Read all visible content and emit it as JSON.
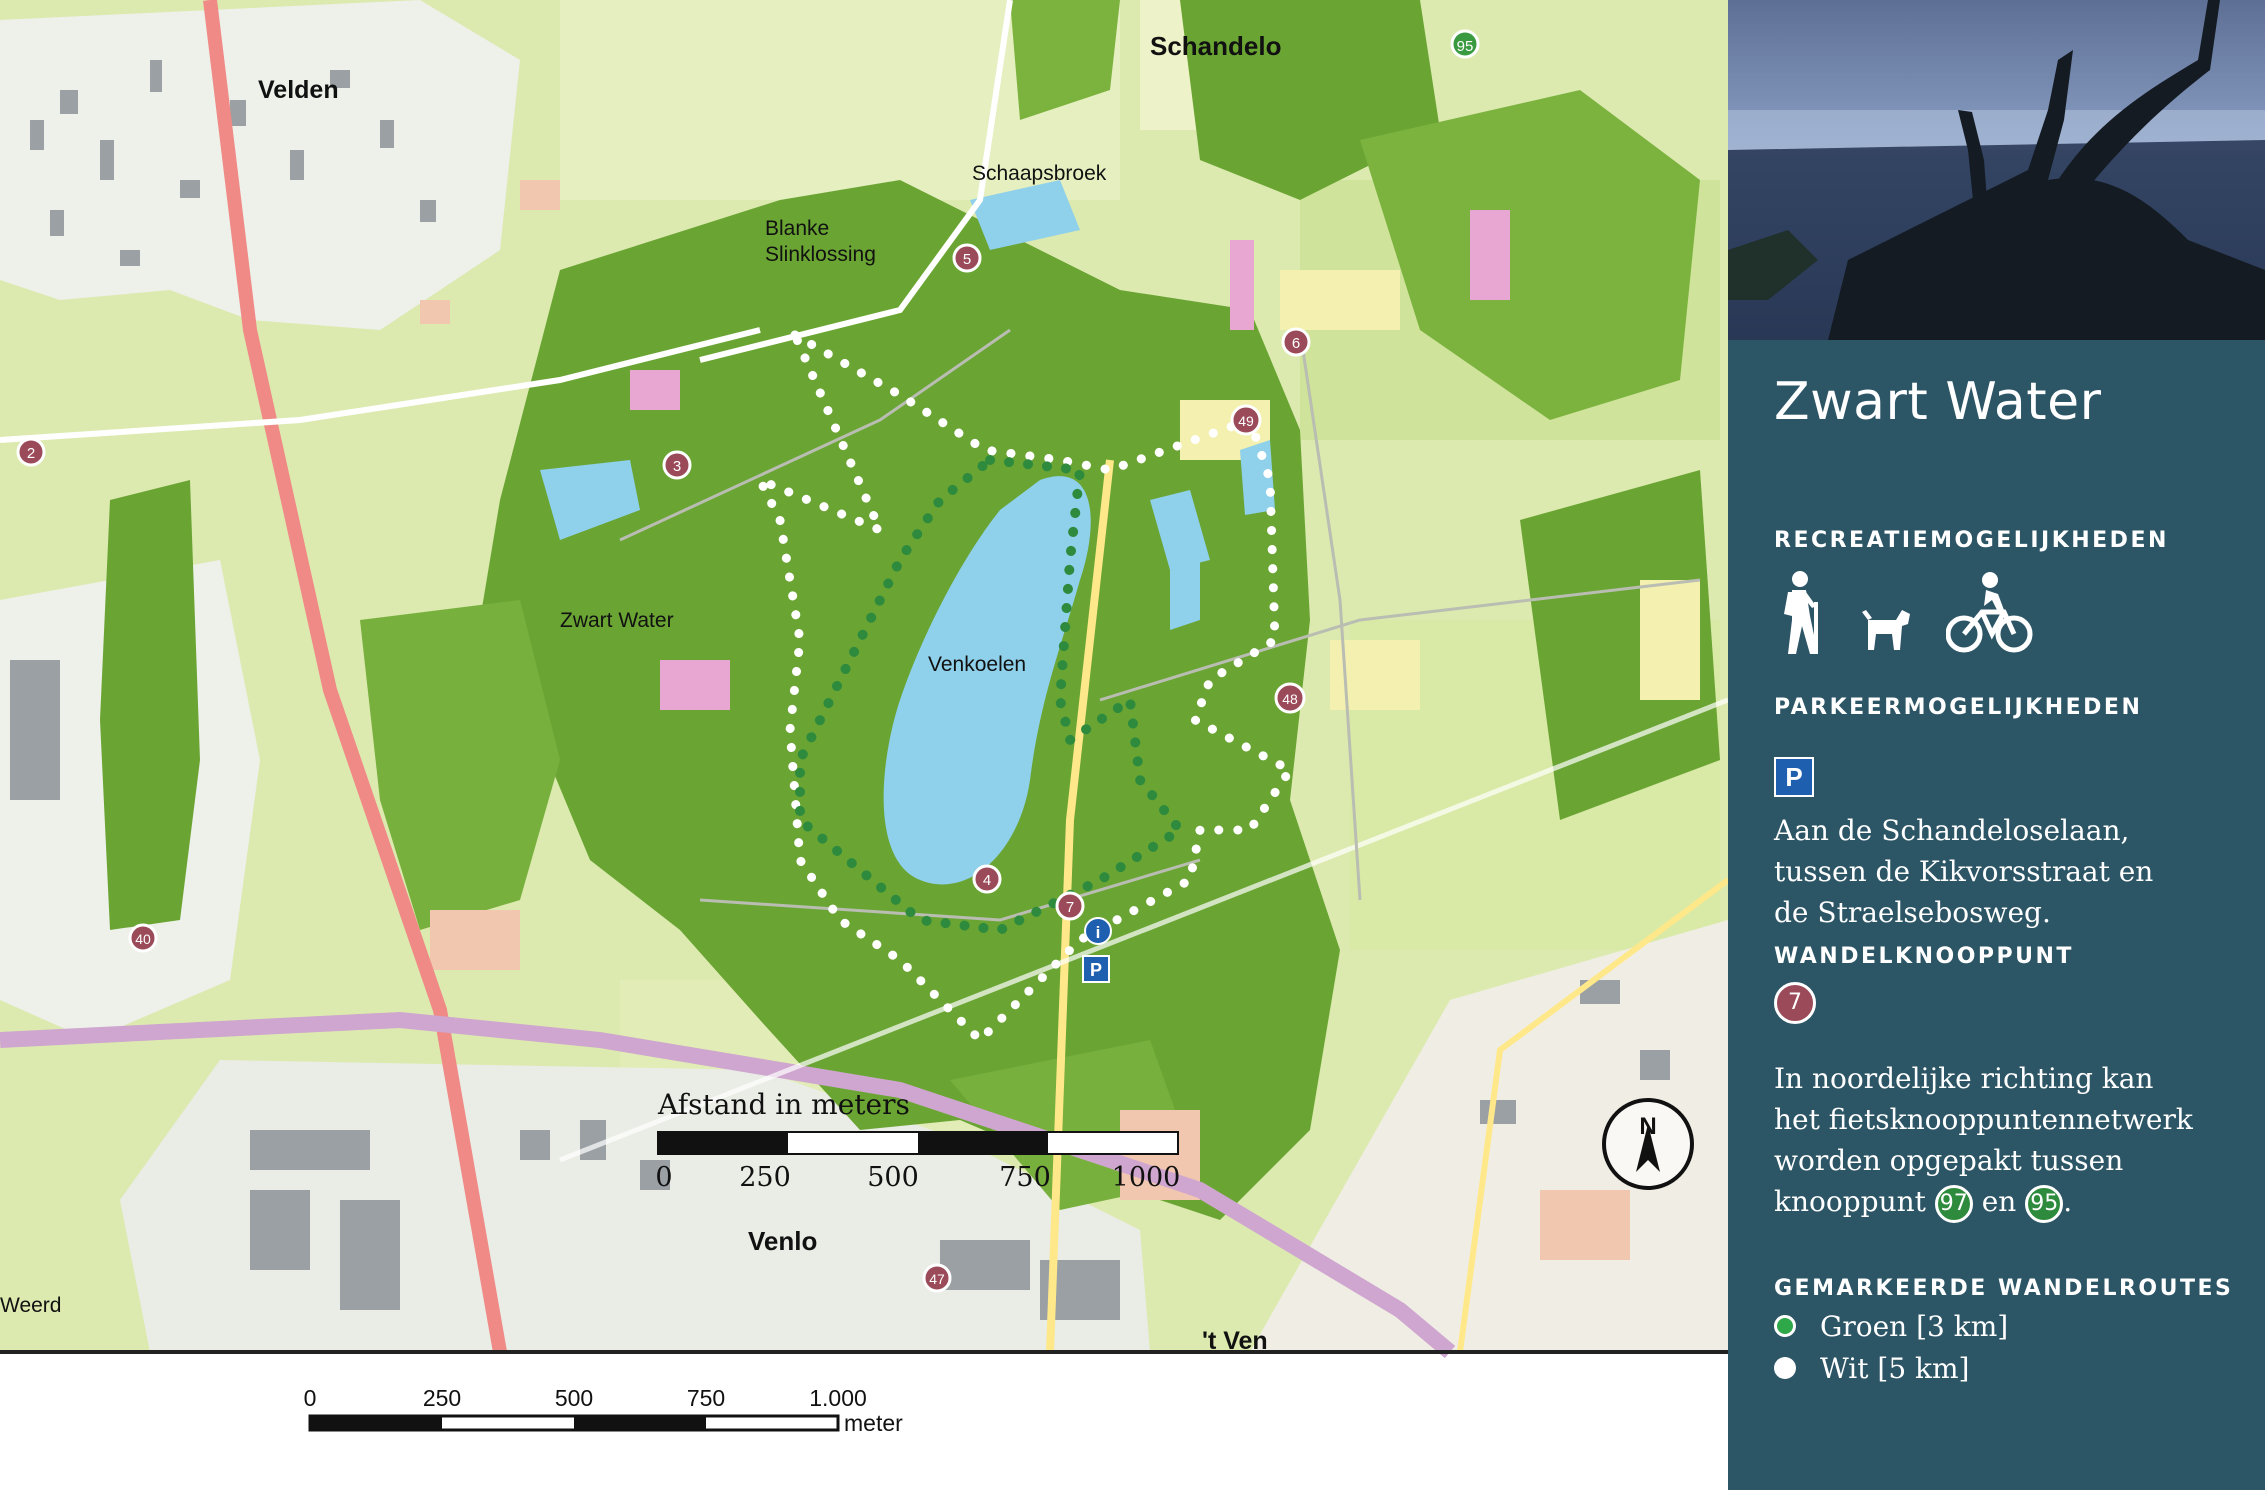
{
  "map": {
    "labels": {
      "schandelo": "Schandelo",
      "velden": "Velden",
      "schaapsbroek": "Schaapsbroek",
      "blanke_line1": "Blanke",
      "blanke_line2": "Slinklossing",
      "zwart_water": "Zwart Water",
      "venkoelen": "Venkoelen",
      "venlo": "Venlo",
      "weerd": "Weerd",
      "t_ven": "'t Ven"
    },
    "junction_nodes": [
      "95",
      "5",
      "6",
      "49",
      "3",
      "2",
      "48",
      "4",
      "7",
      "40",
      "47"
    ],
    "info_marker": "i",
    "parking_marker": "P",
    "north_label": "N",
    "inner_scale": {
      "title": "Afstand in meters",
      "ticks": [
        "0",
        "250",
        "500",
        "750",
        "1000"
      ]
    },
    "bottom_scale": {
      "ticks": [
        "0",
        "250",
        "500",
        "750",
        "1.000"
      ],
      "unit": "meter"
    }
  },
  "panel": {
    "title": "Zwart Water",
    "recreation": {
      "heading": "RECREATIEMOGELIJKHEDEN",
      "icons": [
        "hiker-icon",
        "dog-icon",
        "bicycle-icon"
      ]
    },
    "parking": {
      "heading": "PARKEERMOGELIJKHEDEN",
      "icon_label": "P",
      "lines": [
        "Aan de Schandeloselaan,",
        "tussen de Kikvorsstraat en",
        "de Straelsebosweg."
      ]
    },
    "walking_node": {
      "heading": "WANDELKNOOPPUNT",
      "node": "7"
    },
    "cycling_text": {
      "lines": [
        "In noordelijke richting kan",
        "het fietsknooppuntennetwerk",
        "worden opgepakt tussen"
      ],
      "last_prefix": "knooppunt",
      "node_a": "97",
      "connector": "en",
      "node_b": "95",
      "end": "."
    },
    "routes": {
      "heading": "GEMARKEERDE WANDELROUTES",
      "items": [
        {
          "label": "Groen [3 km]",
          "color": "#2fa84a"
        },
        {
          "label": "Wit [5 km]",
          "color": "#ffffff"
        }
      ]
    }
  },
  "colors": {
    "panel_bg": "#2c5566",
    "forest": "#6aa533",
    "meadow": "#d8e8a8",
    "water": "#8fd0ea",
    "junction": "#9a4a58",
    "green_route": "#2e8b3e"
  }
}
